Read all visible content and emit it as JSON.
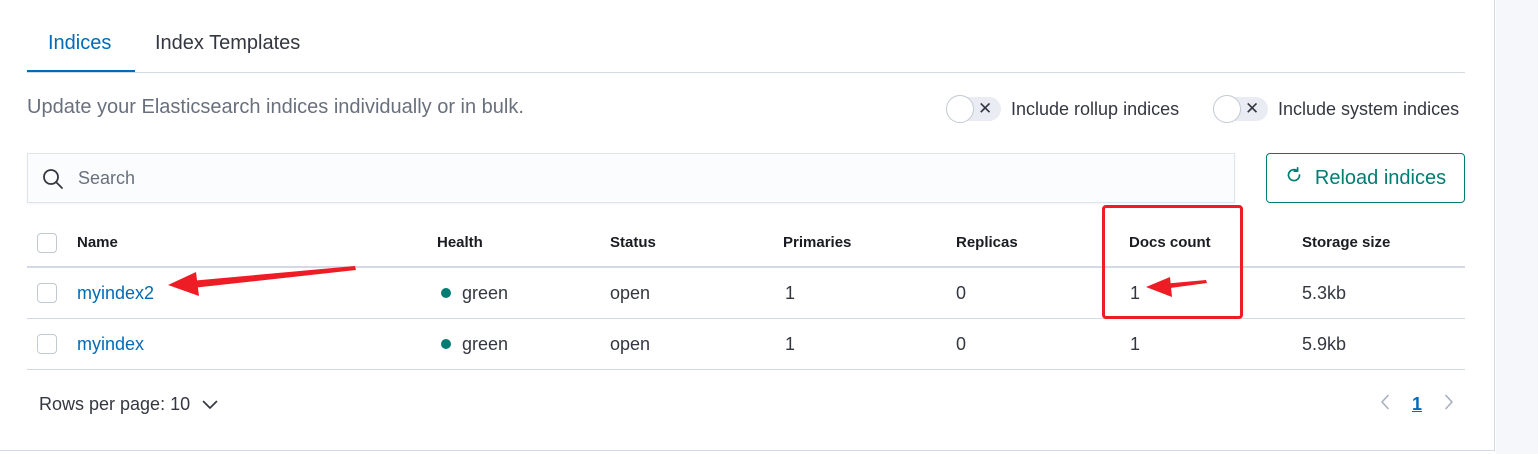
{
  "tabs": [
    {
      "label": "Indices",
      "active": true
    },
    {
      "label": "Index Templates",
      "active": false
    }
  ],
  "description": "Update your Elasticsearch indices individually or in bulk.",
  "toggles": {
    "rollup": {
      "label": "Include rollup indices",
      "checked": false
    },
    "system": {
      "label": "Include system indices",
      "checked": false
    }
  },
  "search": {
    "placeholder": "Search",
    "value": ""
  },
  "reload_button": {
    "label": "Reload indices"
  },
  "table": {
    "columns": [
      "Name",
      "Health",
      "Status",
      "Primaries",
      "Replicas",
      "Docs count",
      "Storage size"
    ],
    "rows": [
      {
        "name": "myindex2",
        "health": "green",
        "status": "open",
        "primaries": "1",
        "replicas": "0",
        "docs_count": "1",
        "storage_size": "5.3kb"
      },
      {
        "name": "myindex",
        "health": "green",
        "status": "open",
        "primaries": "1",
        "replicas": "0",
        "docs_count": "1",
        "storage_size": "5.9kb"
      }
    ]
  },
  "pagination": {
    "rows_per_page_label": "Rows per page: 10",
    "current_page": "1"
  },
  "colors": {
    "primary": "#006bb8",
    "success": "#017d73",
    "health_green": "#017d73",
    "annotation": "#ee1c25"
  }
}
